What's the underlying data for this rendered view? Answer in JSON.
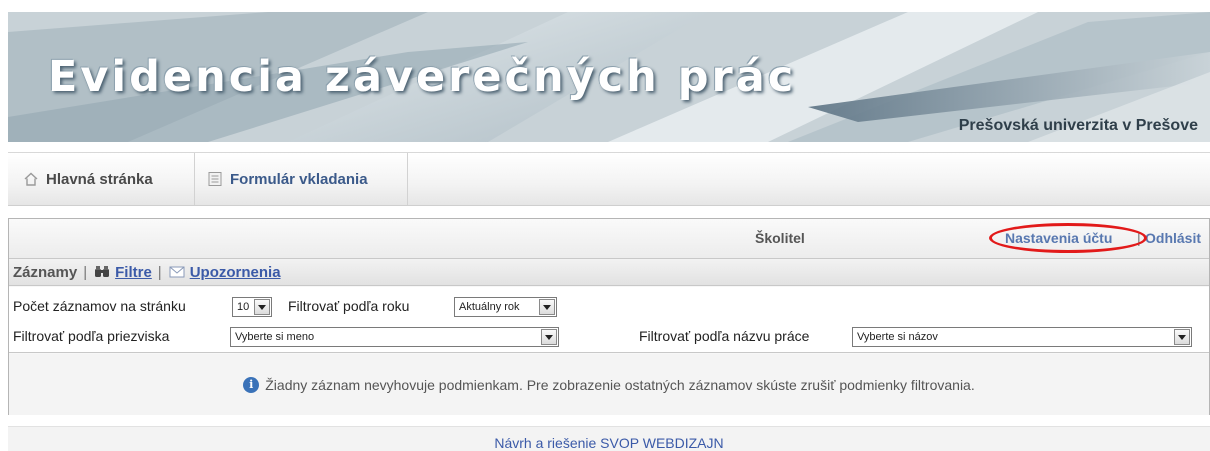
{
  "banner": {
    "title": "Evidencia záverečných prác",
    "institution": "Prešovská univerzita v Prešove"
  },
  "nav": {
    "home_label": "Hlavná stránka",
    "form_label": "Formulár vkladania"
  },
  "topbar": {
    "role": "Školitel",
    "account_settings": "Nastavenia účtu",
    "separator": "|",
    "logout": "Odhlásit"
  },
  "subnav": {
    "records": "Záznamy",
    "filters": "Filtre",
    "notifications": "Upozornenia",
    "separator": "|"
  },
  "filters": {
    "per_page_label": "Počet záznamov na stránku",
    "per_page_value": "10",
    "year_label": "Filtrovať podľa roku",
    "year_value": "Aktuálny rok",
    "surname_label": "Filtrovať podľa priezviska",
    "surname_value": "Vyberte si meno",
    "title_label": "Filtrovať podľa názvu práce",
    "title_value": "Vyberte si názov"
  },
  "notice": {
    "text": "Žiadny záznam nevyhovuje podmienkam. Pre zobrazenie ostatných záznamov skúste zrušiť podmienky filtrovania."
  },
  "footer": {
    "text": "Návrh a riešenie SVOP WEBDIZAJN"
  },
  "colors": {
    "link": "#3b5aa8",
    "highlight_oval": "#e21a1a",
    "info_icon": "#3a72b8"
  },
  "icons": [
    "home-icon",
    "document-icon",
    "binoculars-icon",
    "envelope-icon",
    "info-icon"
  ]
}
